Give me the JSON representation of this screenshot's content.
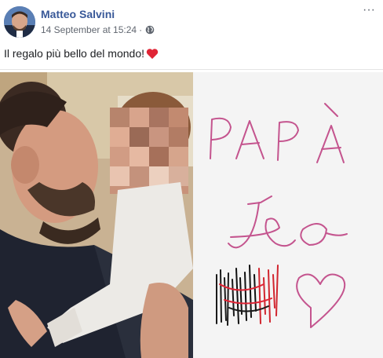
{
  "post": {
    "author_name": "Matteo Salvini",
    "timestamp": "14 September at 15:24",
    "separator": "·",
    "privacy_icon": "globe-icon",
    "more_options_label": "···",
    "caption": "Il regalo più bello del mondo!",
    "caption_emoji": "red-heart-icon"
  },
  "drawing": {
    "text_top": "PAPÀ",
    "text_bottom": "Leo"
  },
  "colors": {
    "author_link": "#385898",
    "meta_text": "#616770",
    "heart": "#e02435",
    "drawing_ink": "#c4548e"
  }
}
